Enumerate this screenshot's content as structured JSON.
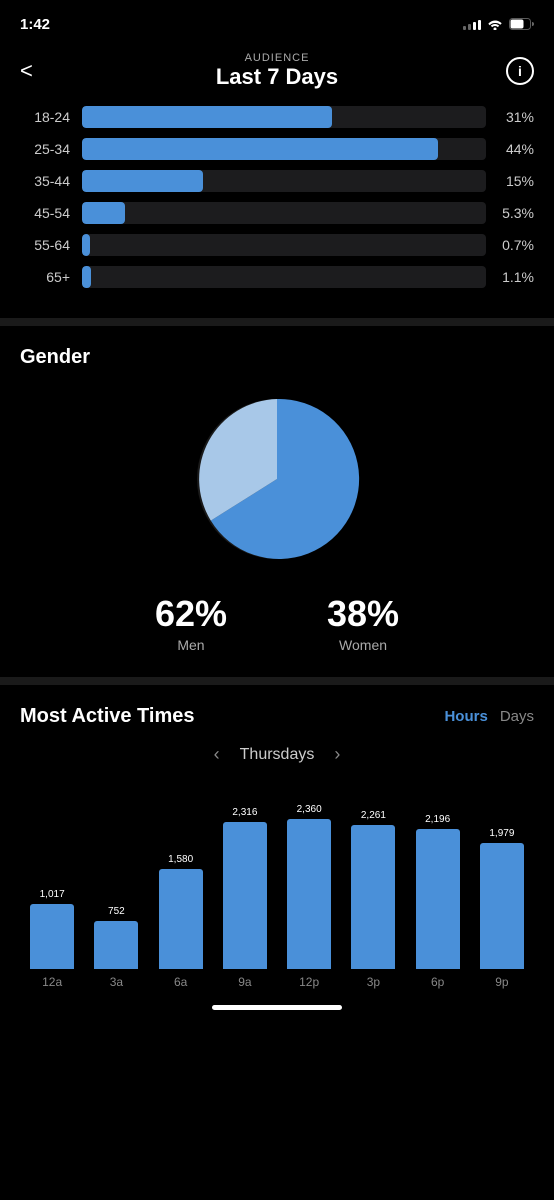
{
  "statusBar": {
    "time": "1:42",
    "signal": [
      2,
      4,
      6,
      8,
      10
    ],
    "battery": 60
  },
  "header": {
    "subtitle": "AUDIENCE",
    "title": "Last 7 Days",
    "back": "<",
    "info": "i"
  },
  "ageGroups": [
    {
      "label": "18-24",
      "percent": "31%",
      "value": 31
    },
    {
      "label": "25-34",
      "percent": "44%",
      "value": 44
    },
    {
      "label": "35-44",
      "percent": "15%",
      "value": 15
    },
    {
      "label": "45-54",
      "percent": "5.3%",
      "value": 5.3
    },
    {
      "label": "55-64",
      "percent": "0.7%",
      "value": 0.7
    },
    {
      "label": "65+",
      "percent": "1.1%",
      "value": 1.1
    }
  ],
  "gender": {
    "title": "Gender",
    "men": {
      "percent": "62%",
      "label": "Men"
    },
    "women": {
      "percent": "38%",
      "label": "Women"
    }
  },
  "activeTimesSection": {
    "title": "Most Active Times",
    "toggleHours": "Hours",
    "toggleDays": "Days",
    "dayLabel": "Thursdays",
    "bars": [
      {
        "label": "12a",
        "value": 1017,
        "display": "1,017"
      },
      {
        "label": "3a",
        "value": 752,
        "display": "752"
      },
      {
        "label": "6a",
        "value": 1580,
        "display": "1,580"
      },
      {
        "label": "9a",
        "value": 2316,
        "display": "2,316"
      },
      {
        "label": "12p",
        "value": 2360,
        "display": "2,360"
      },
      {
        "label": "3p",
        "value": 2261,
        "display": "2,261"
      },
      {
        "label": "6p",
        "value": 2196,
        "display": "2,196"
      },
      {
        "label": "9p",
        "value": 1979,
        "display": "1,979"
      }
    ],
    "maxValue": 2360
  }
}
